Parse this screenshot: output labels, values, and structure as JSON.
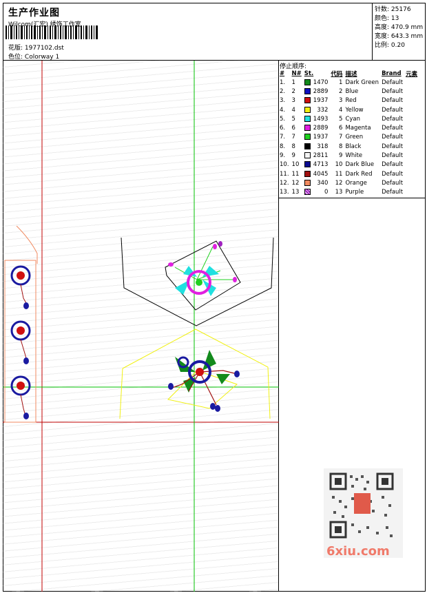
{
  "header": {
    "title": "生产作业图",
    "company": "Wilcom(汇宏) 绣饰工作室",
    "design_label": "花版:",
    "design_value": "1977102.dst",
    "colorway_label": "色位:",
    "colorway_value": "Colorway 1"
  },
  "stats": [
    {
      "label": "针数:",
      "value": "25176"
    },
    {
      "label": "颜色:",
      "value": "13"
    },
    {
      "label": "高度:",
      "value": "470.9 mm"
    },
    {
      "label": "宽度:",
      "value": "643.3 mm"
    },
    {
      "label": "比例:",
      "value": "0.20"
    }
  ],
  "color_table": {
    "title": "停止顺序:",
    "headers": [
      "#",
      "N#",
      "St.",
      "代码",
      "描述",
      "Brand",
      "元素"
    ],
    "rows": [
      {
        "idx": "1.",
        "n": "1",
        "color": "#138a1c",
        "st": "1470",
        "code": "1",
        "desc": "Dark Green",
        "brand": "Default"
      },
      {
        "idx": "2.",
        "n": "2",
        "color": "#1010c0",
        "st": "2889",
        "code": "2",
        "desc": "Blue",
        "brand": "Default"
      },
      {
        "idx": "3.",
        "n": "3",
        "color": "#d01010",
        "st": "1937",
        "code": "3",
        "desc": "Red",
        "brand": "Default"
      },
      {
        "idx": "4.",
        "n": "4",
        "color": "#f0f010",
        "st": "332",
        "code": "4",
        "desc": "Yellow",
        "brand": "Default"
      },
      {
        "idx": "5.",
        "n": "5",
        "color": "#20e0e0",
        "st": "1493",
        "code": "5",
        "desc": "Cyan",
        "brand": "Default"
      },
      {
        "idx": "6.",
        "n": "6",
        "color": "#e020e0",
        "st": "2889",
        "code": "6",
        "desc": "Magenta",
        "brand": "Default"
      },
      {
        "idx": "7.",
        "n": "7",
        "color": "#20d020",
        "st": "1937",
        "code": "7",
        "desc": "Green",
        "brand": "Default"
      },
      {
        "idx": "8.",
        "n": "8",
        "color": "#000000",
        "st": "318",
        "code": "8",
        "desc": "Black",
        "brand": "Default"
      },
      {
        "idx": "9.",
        "n": "9",
        "color": "#f4f4f4",
        "st": "2811",
        "code": "9",
        "desc": "White",
        "brand": "Default"
      },
      {
        "idx": "10.",
        "n": "10",
        "color": "#0a0a90",
        "st": "4713",
        "code": "10",
        "desc": "Dark Blue",
        "brand": "Default"
      },
      {
        "idx": "11.",
        "n": "11",
        "color": "#a01010",
        "st": "4045",
        "code": "11",
        "desc": "Dark Red",
        "brand": "Default"
      },
      {
        "idx": "12.",
        "n": "12",
        "color": "#f08a60",
        "st": "340",
        "code": "12",
        "desc": "Orange",
        "brand": "Default"
      },
      {
        "idx": "13.",
        "n": "13",
        "color": "#a020c0",
        "st": "0",
        "code": "13",
        "desc": "Purple",
        "brand": "Default"
      }
    ]
  },
  "watermark": {
    "site": "6xiu.com",
    "icon": "qr-code-icon"
  }
}
